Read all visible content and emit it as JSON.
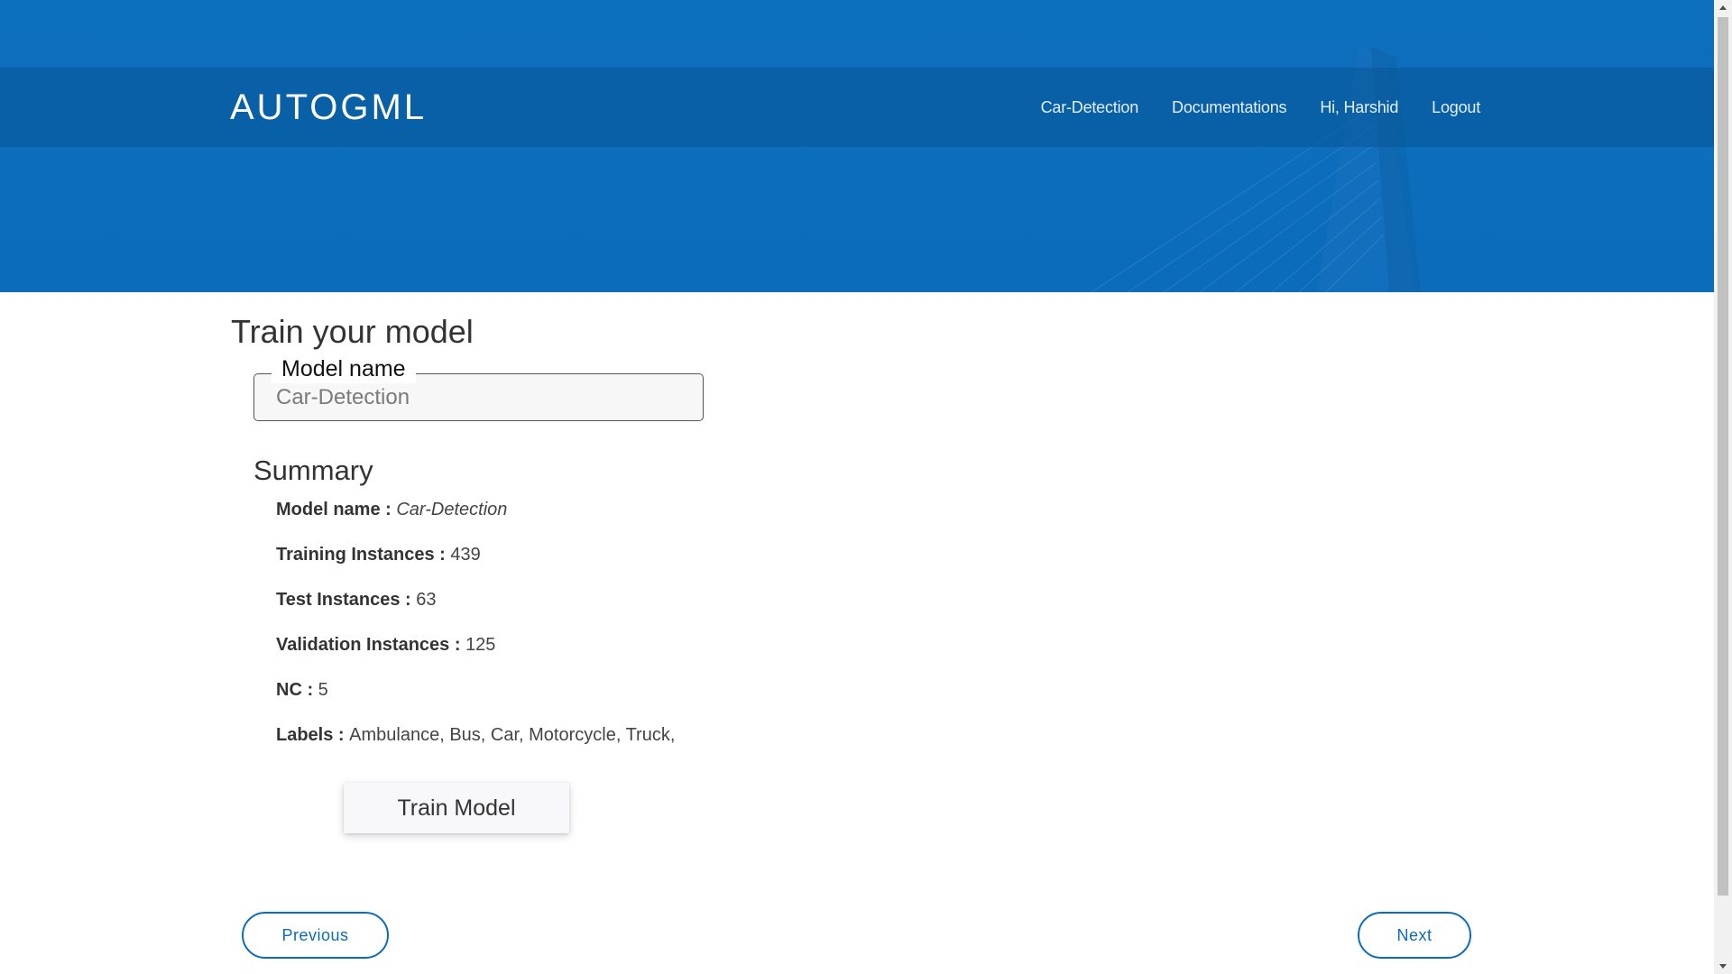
{
  "header": {
    "brand": "AUTOGML",
    "nav": [
      {
        "label": "Car-Detection"
      },
      {
        "label": "Documentations"
      },
      {
        "label": "Hi, Harshid"
      },
      {
        "label": "Logout"
      }
    ]
  },
  "main": {
    "title": "Train your model",
    "model_field": {
      "legend": "Model name",
      "value": "Car-Detection"
    },
    "summary": {
      "title": "Summary",
      "rows": [
        {
          "key": "Model name : ",
          "value": "Car-Detection"
        },
        {
          "key": "Training Instances : ",
          "value": "439"
        },
        {
          "key": "Test Instances : ",
          "value": "63"
        },
        {
          "key": "Validation Instances : ",
          "value": "125"
        },
        {
          "key": "NC : ",
          "value": "5"
        },
        {
          "key": "Labels : ",
          "value": "Ambulance, Bus, Car, Motorcycle, Truck,"
        }
      ]
    },
    "train_button": "Train Model"
  },
  "pager": {
    "previous": "Previous",
    "next": "Next"
  },
  "colors": {
    "brand_blue": "#0b6cbb",
    "nav_bar": "#0a5c9f",
    "text": "#333333"
  },
  "icons": {
    "scroll_up": "triangle-up-icon",
    "scroll_down": "triangle-down-icon"
  }
}
